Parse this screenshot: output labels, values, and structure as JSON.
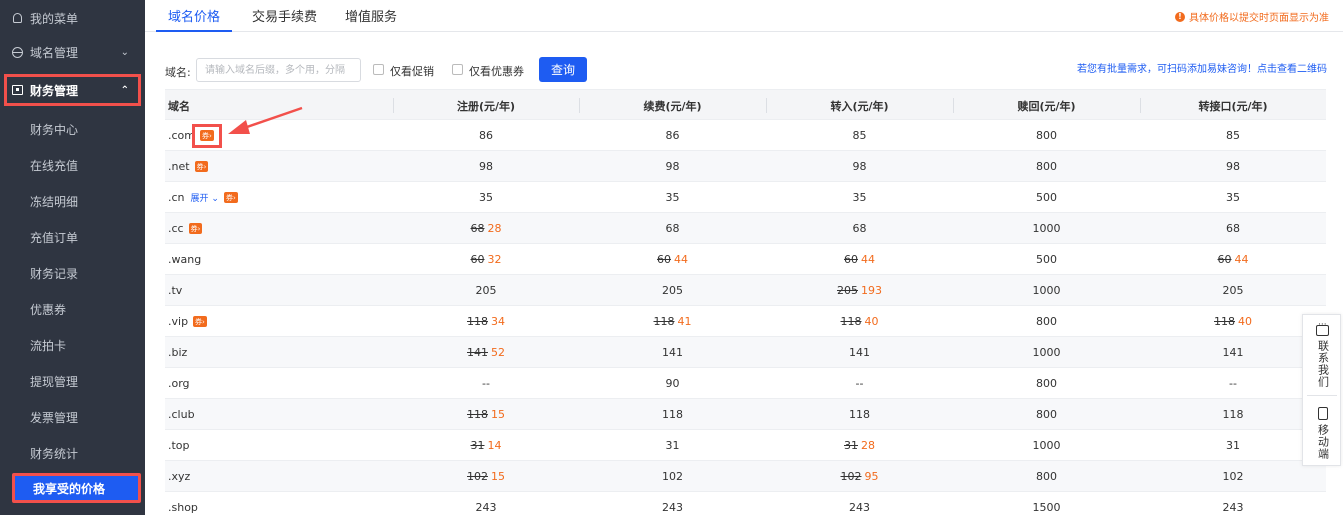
{
  "sidebar": {
    "menus": [
      {
        "label": "我的菜单",
        "icon": "user-icon"
      },
      {
        "label": "域名管理",
        "icon": "globe-icon",
        "chevron": "⌄"
      },
      {
        "label": "财务管理",
        "icon": "wallet-icon",
        "chevron": "⌃"
      }
    ],
    "items": [
      "财务中心",
      "在线充值",
      "冻结明细",
      "充值订单",
      "财务记录",
      "优惠券",
      "流拍卡",
      "提现管理",
      "发票管理",
      "财务统计",
      "我享受的价格"
    ]
  },
  "tabs": [
    "域名价格",
    "交易手续费",
    "增值服务"
  ],
  "notice": "具体价格以提交时页面显示为准",
  "filter": {
    "label": "域名:",
    "placeholder": "请输入域名后缀，多个用，分隔",
    "promo_label": "仅看促销",
    "coupon_label": "仅看优惠券",
    "query_label": "查询",
    "bulk_link": "若您有批量需求，可扫码添加易妹咨询！点击查看二维码"
  },
  "table": {
    "headers": [
      "域名",
      "注册(元/年)",
      "续费(元/年)",
      "转入(元/年)",
      "赎回(元/年)",
      "转接口(元/年)"
    ],
    "coupon_text": "券",
    "expand_text": "展开",
    "rows": [
      {
        "name": ".com",
        "coupon": true,
        "cells": [
          {
            "p": "86"
          },
          {
            "p": "86"
          },
          {
            "p": "85"
          },
          {
            "p": "800"
          },
          {
            "p": "85"
          }
        ]
      },
      {
        "name": ".net",
        "coupon": true,
        "cells": [
          {
            "p": "98"
          },
          {
            "p": "98"
          },
          {
            "p": "98"
          },
          {
            "p": "800"
          },
          {
            "p": "98"
          }
        ]
      },
      {
        "name": ".cn",
        "coupon": true,
        "expand": true,
        "cells": [
          {
            "p": "35"
          },
          {
            "p": "35"
          },
          {
            "p": "35"
          },
          {
            "p": "500"
          },
          {
            "p": "35"
          }
        ]
      },
      {
        "name": ".cc",
        "coupon": true,
        "cells": [
          {
            "o": "68",
            "p": "28"
          },
          {
            "p": "68"
          },
          {
            "p": "68"
          },
          {
            "p": "1000"
          },
          {
            "p": "68"
          }
        ]
      },
      {
        "name": ".wang",
        "cells": [
          {
            "o": "60",
            "p": "32"
          },
          {
            "o": "60",
            "p": "44"
          },
          {
            "o": "60",
            "p": "44"
          },
          {
            "p": "500"
          },
          {
            "o": "60",
            "p": "44"
          }
        ]
      },
      {
        "name": ".tv",
        "cells": [
          {
            "p": "205"
          },
          {
            "p": "205"
          },
          {
            "o": "205",
            "p": "193"
          },
          {
            "p": "1000"
          },
          {
            "p": "205"
          }
        ]
      },
      {
        "name": ".vip",
        "coupon": true,
        "cells": [
          {
            "o": "118",
            "p": "34"
          },
          {
            "o": "118",
            "p": "41"
          },
          {
            "o": "118",
            "p": "40"
          },
          {
            "p": "800"
          },
          {
            "o": "118",
            "p": "40"
          }
        ]
      },
      {
        "name": ".biz",
        "cells": [
          {
            "o": "141",
            "p": "52"
          },
          {
            "p": "141"
          },
          {
            "p": "141"
          },
          {
            "p": "1000"
          },
          {
            "p": "141"
          }
        ]
      },
      {
        "name": ".org",
        "cells": [
          {
            "p": "--"
          },
          {
            "p": "90"
          },
          {
            "p": "--"
          },
          {
            "p": "800"
          },
          {
            "p": "--"
          }
        ]
      },
      {
        "name": ".club",
        "cells": [
          {
            "o": "118",
            "p": "15"
          },
          {
            "p": "118"
          },
          {
            "p": "118"
          },
          {
            "p": "800"
          },
          {
            "p": "118"
          }
        ]
      },
      {
        "name": ".top",
        "cells": [
          {
            "o": "31",
            "p": "14"
          },
          {
            "p": "31"
          },
          {
            "o": "31",
            "p": "28"
          },
          {
            "p": "1000"
          },
          {
            "p": "31"
          }
        ]
      },
      {
        "name": ".xyz",
        "cells": [
          {
            "o": "102",
            "p": "15"
          },
          {
            "p": "102"
          },
          {
            "o": "102",
            "p": "95"
          },
          {
            "p": "800"
          },
          {
            "p": "102"
          }
        ]
      },
      {
        "name": ".shop",
        "cells": [
          {
            "p": "243"
          },
          {
            "p": "243"
          },
          {
            "p": "243"
          },
          {
            "p": "1500"
          },
          {
            "p": "243"
          }
        ]
      }
    ]
  },
  "side_panel": {
    "contact": "联系我们",
    "mobile": "移动端"
  },
  "colors": {
    "accent": "#1e5cf2",
    "sidebar_bg": "#2f3541",
    "highlight": "#f2504b",
    "promo": "#f26b1d"
  }
}
